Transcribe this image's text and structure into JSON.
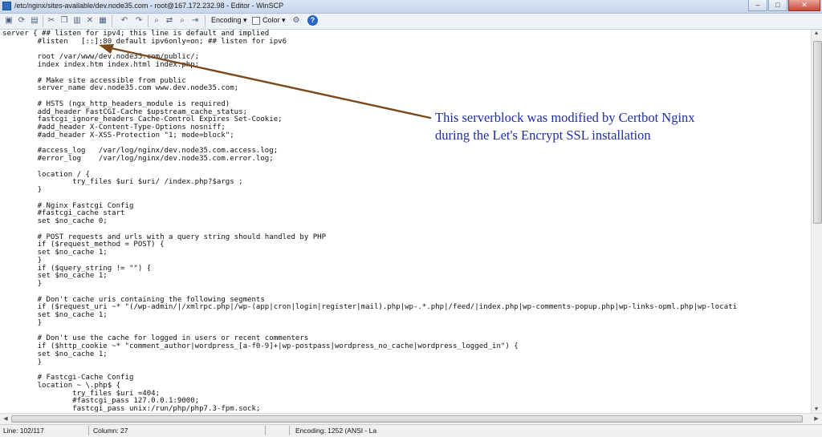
{
  "window": {
    "title": "/etc/nginx/sites-available/dev.node35.com - root@167.172.232.98 - Editor - WinSCP",
    "minimize": "–",
    "maximize": "□",
    "close": "✕"
  },
  "toolbar": {
    "encoding_label": "Encoding ▾",
    "color_label": "Color ▾",
    "help_label": "?"
  },
  "editor": {
    "lines": [
      "server { ## listen for ipv4; this line is default and implied",
      "        #listen   [::]:80 default ipv6only=on; ## listen for ipv6",
      "",
      "        root /var/www/dev.node35.com/public/;",
      "        index index.htm index.html index.php;",
      "",
      "        # Make site accessible from public",
      "        server_name dev.node35.com www.dev.node35.com;",
      "",
      "        # HSTS (ngx_http_headers_module is required)",
      "        add_header FastCGI-Cache $upstream_cache_status;",
      "        fastcgi_ignore_headers Cache-Control Expires Set-Cookie;",
      "        #add_header X-Content-Type-Options nosniff;",
      "        #add_header X-XSS-Protection \"1; mode=block\";",
      "",
      "        #access_log   /var/log/nginx/dev.node35.com.access.log;",
      "        #error_log    /var/log/nginx/dev.node35.com.error.log;",
      "",
      "        location / {",
      "                try_files $uri $uri/ /index.php?$args ;",
      "        }",
      "",
      "        # Nginx Fastcgi Config",
      "        #fastcgi_cache start",
      "        set $no_cache 0;",
      "",
      "        # POST requests and urls with a query string should handled by PHP",
      "        if ($request_method = POST) {",
      "        set $no_cache 1;",
      "        }",
      "        if ($query_string != \"\") {",
      "        set $no_cache 1;",
      "        }",
      "",
      "        # Don't cache uris containing the following segments",
      "        if ($request_uri ~* \"(/wp-admin/|/xmlrpc.php|/wp-(app|cron|login|register|mail).php|wp-.*.php|/feed/|index.php|wp-comments-popup.php|wp-links-opml.php|wp-locati",
      "        set $no_cache 1;",
      "        }",
      "",
      "        # Don't use the cache for logged in users or recent commenters",
      "        if ($http_cookie ~* \"comment_author|wordpress_[a-f0-9]+|wp-postpass|wordpress_no_cache|wordpress_logged_in\") {",
      "        set $no_cache 1;",
      "        }",
      "",
      "        # Fastcgi-Cache Config",
      "        location ~ \\.php$ {",
      "                try_files $uri =404;",
      "                #fastcgi_pass 127.0.0.1:9000;",
      "                fastcgi_pass unix:/run/php/php7.3-fpm.sock;"
    ]
  },
  "annotation": {
    "line1": "This serverblock was modified by Certbot Nginx",
    "line2": "during the Let's Encrypt SSL installation",
    "color": "#1f2fa3",
    "arrow_color": "#7a4a1e"
  },
  "status": {
    "line": "Line: 102/117",
    "column": "Column: 27",
    "encoding": "Encoding: 1252  (ANSI - La"
  }
}
